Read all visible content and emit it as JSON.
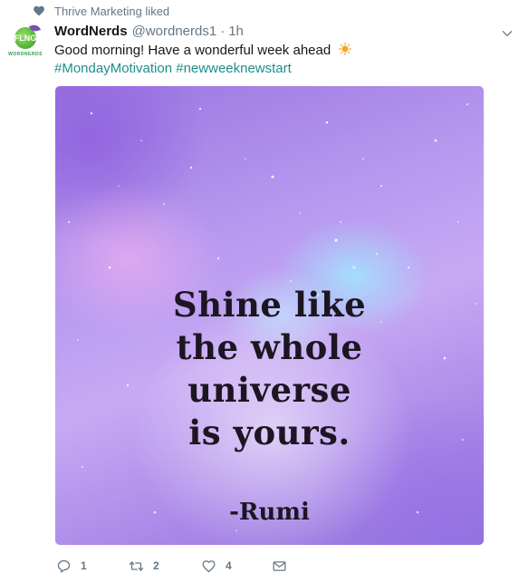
{
  "social_context": {
    "text": "Thrive Marketing liked"
  },
  "author": {
    "display_name": "WordNerds",
    "handle": "@wordnerds1",
    "separator": "·",
    "time": "1h",
    "avatar_text": "FLNG",
    "avatar_caption": "WORDNERDS"
  },
  "tweet": {
    "text": "Good morning! Have a wonderful week ahead",
    "hashtags": [
      "#MondayMotivation",
      "#newweeknewstart"
    ]
  },
  "media": {
    "quote_lines": [
      "Shine like",
      "the whole",
      "universe",
      "is yours."
    ],
    "attribution": "-Rumi"
  },
  "actions": {
    "reply_count": "1",
    "retweet_count": "2",
    "like_count": "4"
  },
  "icons": {
    "heart": "heart-icon",
    "caret": "chevron-down-icon",
    "reply": "reply-icon",
    "retweet": "retweet-icon",
    "like": "like-icon",
    "message": "direct-message-icon",
    "emoji": "sun-emoji"
  },
  "colors": {
    "hashtag": "#1d8f8a",
    "muted": "#657786",
    "text": "#14171a"
  }
}
